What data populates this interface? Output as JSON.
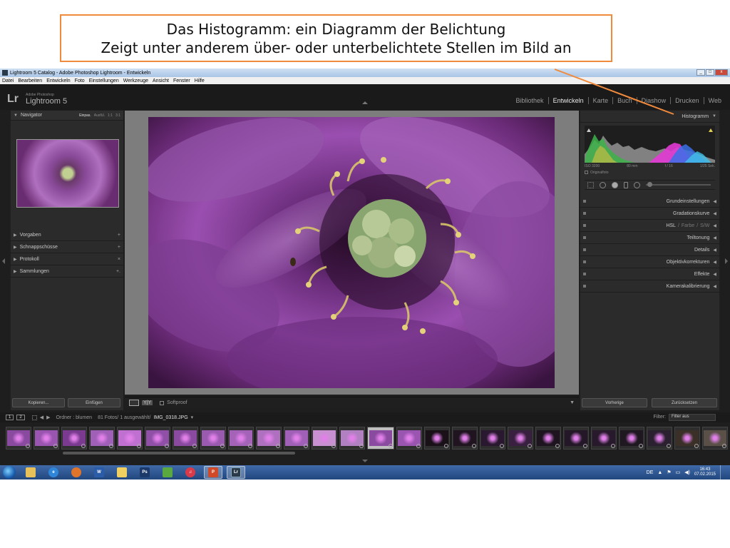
{
  "callout": {
    "line1": "Das Histogramm: ein Diagramm der Belichtung",
    "line2": "Zeigt unter anderem über- oder unterbelichtete Stellen im Bild an"
  },
  "window": {
    "title": "Lightroom 5 Catalog - Adobe Photoshop Lightroom - Entwickeln",
    "buttons": [
      "_",
      "□",
      "x"
    ]
  },
  "menubar": [
    "Datei",
    "Bearbeiten",
    "Entwickeln",
    "Foto",
    "Einstellungen",
    "Werkzeuge",
    "Ansicht",
    "Fenster",
    "Hilfe"
  ],
  "app": {
    "logo": "Lr",
    "vendor": "Adobe Photoshop",
    "name": "Lightroom 5",
    "modules": [
      "Bibliothek",
      "Entwickeln",
      "Karte",
      "Buch",
      "Diashow",
      "Drucken",
      "Web"
    ],
    "active_module": "Entwickeln"
  },
  "left": {
    "navigator": {
      "title": "Navigator",
      "options": [
        "Einpas.",
        "Ausfül.",
        "1:1",
        "3:1"
      ],
      "selected": "Einpas."
    },
    "sections": [
      {
        "label": "Vorgaben",
        "action": "+"
      },
      {
        "label": "Schnappschüsse",
        "action": "+"
      },
      {
        "label": "Protokoll",
        "action": "×"
      },
      {
        "label": "Sammlungen",
        "action": "+."
      }
    ],
    "buttons": {
      "copy": "Kopieren...",
      "paste": "Einfügen"
    }
  },
  "right": {
    "histogram": {
      "title": "Histogramm",
      "iso": "ISO 3200",
      "focal": "80 mm",
      "aperture": "f / 16",
      "shutter": "1/25 Sek.",
      "original": "Originalfoto"
    },
    "sections": [
      "Grundeinstellungen",
      "Gradationskurve",
      "Teiltonung",
      "Details",
      "Objektivkorrekturen",
      "Effekte",
      "Kamerakalibrierung"
    ],
    "hsl": {
      "a": "HSL",
      "b": "Farbe",
      "c": "S/W"
    },
    "buttons": {
      "prev": "Vorherige",
      "reset": "Zurücksetzen"
    }
  },
  "toolbar": {
    "yy": "Y|Y",
    "softproof": "Softproof"
  },
  "filmbar": {
    "page1": "1",
    "page2": "2",
    "folder": "Ordner : blumen",
    "count": "81 Fotos/ 1 ausgewählt/",
    "filename": "IMG_0318.JPG",
    "filter_label": "Filter:",
    "filter_value": "Filter aus"
  },
  "taskbar": {
    "lang": "DE",
    "time": "16:43",
    "date": "07.02.2015",
    "apps": [
      "explorer",
      "ie",
      "firefox",
      "word",
      "folder",
      "photoshop",
      "chrome-green",
      "itunes",
      "powerpoint",
      "lightroom"
    ]
  },
  "colors": {
    "callout_border": "#f08a3c",
    "lr_dark": "#1a1a1a",
    "panel": "#2b2b2b",
    "taskbar": "#2f5b98"
  }
}
